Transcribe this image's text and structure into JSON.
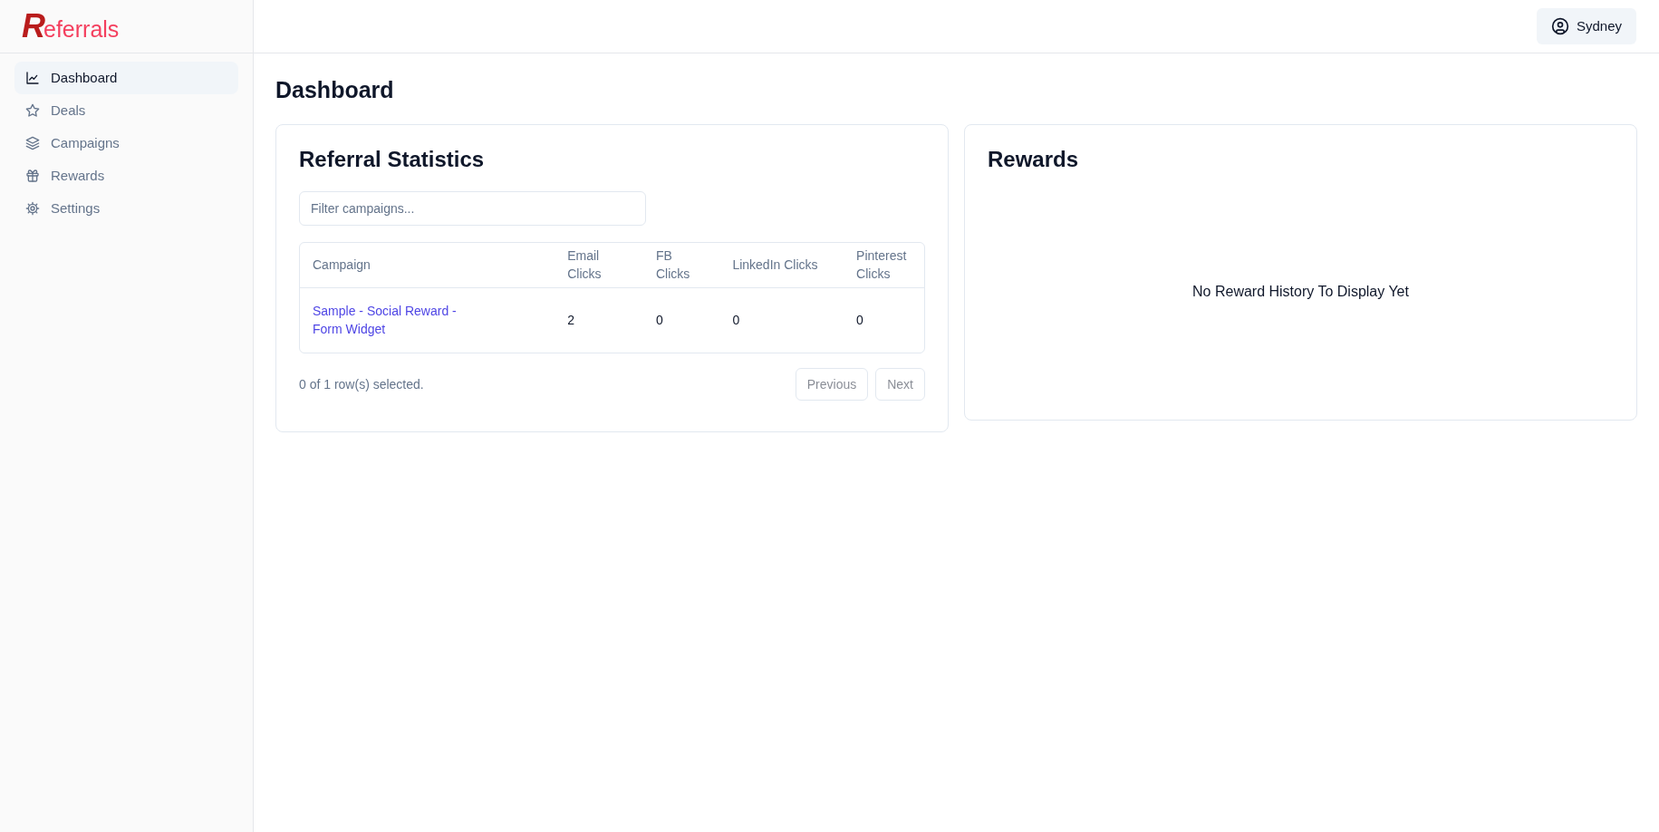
{
  "app": {
    "logo": "Referrals"
  },
  "header": {
    "user": "Sydney"
  },
  "sidebar": {
    "items": [
      {
        "label": "Dashboard",
        "selected": true
      },
      {
        "label": "Deals",
        "selected": false
      },
      {
        "label": "Campaigns",
        "selected": false
      },
      {
        "label": "Rewards",
        "selected": false
      },
      {
        "label": "Settings",
        "selected": false
      }
    ]
  },
  "page": {
    "title": "Dashboard"
  },
  "referral_statistics": {
    "title": "Referral Statistics",
    "filter": {
      "placeholder": "Filter campaigns..."
    },
    "table": {
      "columns": [
        "Campaign",
        "Email Clicks",
        "FB Clicks",
        "LinkedIn Clicks",
        "Pinterest Clicks"
      ],
      "rows": [
        {
          "cells": [
            "Sample - Social Reward - Form Widget",
            "2",
            "0",
            "0",
            "0"
          ]
        }
      ]
    },
    "selection_status": "0 of 1 row(s) selected.",
    "pagination": [
      {
        "label": "Previous",
        "disabled": true
      },
      {
        "label": "Next",
        "disabled": true
      }
    ]
  },
  "rewards": {
    "title": "Rewards",
    "empty_message": "No Reward History To Display Yet"
  }
}
